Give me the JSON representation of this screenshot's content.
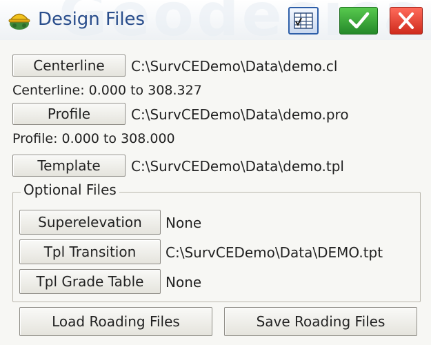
{
  "window": {
    "title": "Design Files",
    "watermark": "Geodesical"
  },
  "toolbar": {
    "grid_icon": "table-icon",
    "ok_icon": "checkmark-icon",
    "close_icon": "x-icon"
  },
  "files": {
    "centerline": {
      "button": "Centerline",
      "path": "C:\\SurvCEDemo\\Data\\demo.cl",
      "range": "Centerline: 0.000 to 308.327"
    },
    "profile": {
      "button": "Profile",
      "path": "C:\\SurvCEDemo\\Data\\demo.pro",
      "range": "Profile: 0.000 to 308.000"
    },
    "template": {
      "button": "Template",
      "path": "C:\\SurvCEDemo\\Data\\demo.tpl"
    }
  },
  "optional": {
    "legend": "Optional Files",
    "superelevation": {
      "button": "Superelevation",
      "value": "None"
    },
    "tpl_transition": {
      "button": "Tpl Transition",
      "value": "C:\\SurvCEDemo\\Data\\DEMO.tpt"
    },
    "tpl_grade_table": {
      "button": "Tpl Grade Table",
      "value": "None"
    }
  },
  "actions": {
    "load": "Load Roading Files",
    "save": "Save Roading Files"
  },
  "colors": {
    "title_text": "#2a4e8c",
    "ok_green": "#2fa133",
    "close_red": "#e2382a"
  }
}
